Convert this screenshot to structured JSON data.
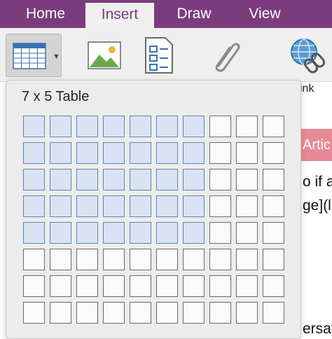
{
  "ribbon": {
    "tabs": [
      {
        "label": "Home"
      },
      {
        "label": "Insert"
      },
      {
        "label": "Draw"
      },
      {
        "label": "View"
      }
    ],
    "active_tab": "Insert",
    "accent_color": "#7b3c7e",
    "buttons": [
      {
        "icon": "table-icon"
      },
      {
        "icon": "picture-icon"
      },
      {
        "icon": "file-printout-icon"
      },
      {
        "icon": "attachment-icon"
      },
      {
        "icon": "link-icon"
      }
    ],
    "link_label_partial": "ink"
  },
  "table_picker": {
    "title": "7 x 5 Table",
    "columns": 10,
    "rows": 8,
    "selected_columns": 7,
    "selected_rows": 5,
    "selected_color": "#d9e3f3"
  },
  "document": {
    "header_partial": "Artic",
    "lines_partial": [
      "o if a",
      "ge](l",
      "ersati"
    ]
  }
}
